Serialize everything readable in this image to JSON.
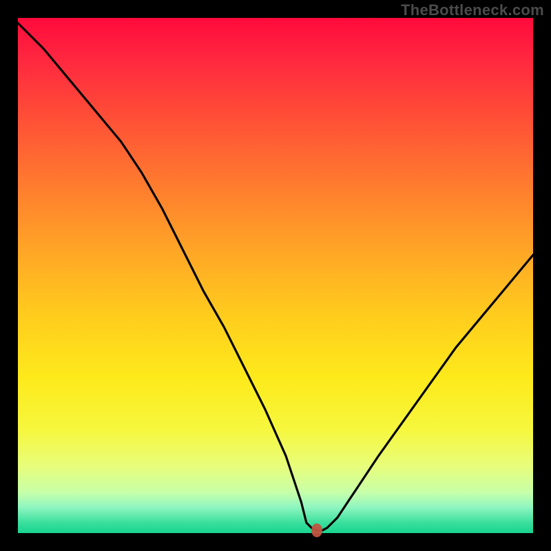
{
  "watermark": "TheBottleneck.com",
  "chart_data": {
    "type": "line",
    "title": "",
    "xlabel": "",
    "ylabel": "",
    "xlim": [
      0,
      100
    ],
    "ylim": [
      0,
      100
    ],
    "grid": false,
    "legend": false,
    "annotations": [
      {
        "name": "marker-dot",
        "x": 58,
        "y": 0.5,
        "color": "#c0543f"
      }
    ],
    "series": [
      {
        "name": "bottleneck-curve",
        "color": "#000000",
        "x": [
          0,
          5,
          10,
          15,
          20,
          24,
          28,
          32,
          36,
          40,
          44,
          48,
          52,
          55,
          56,
          57,
          58,
          59,
          60,
          62,
          66,
          70,
          75,
          80,
          85,
          90,
          95,
          100
        ],
        "y": [
          99,
          94,
          88,
          82,
          76,
          70,
          63,
          55,
          47,
          40,
          32,
          24,
          15,
          6,
          2,
          1,
          0.5,
          0.5,
          1,
          3,
          9,
          15,
          22,
          29,
          36,
          42,
          48,
          54
        ]
      }
    ],
    "background_gradient": {
      "top": "#ff0a3b",
      "middle": "#ffe31d",
      "bottom": "#17d48f"
    }
  }
}
